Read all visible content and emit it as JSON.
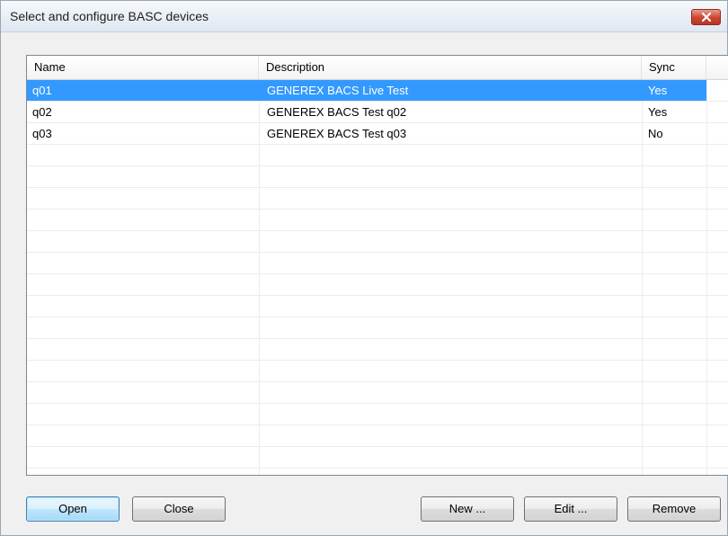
{
  "window": {
    "title": "Select and configure BASC devices"
  },
  "list": {
    "columns": [
      {
        "label": "Name"
      },
      {
        "label": "Description"
      },
      {
        "label": "Sync"
      }
    ],
    "rows": [
      {
        "name": "q01",
        "description": "GENEREX BACS Live Test",
        "sync": "Yes",
        "selected": true
      },
      {
        "name": "q02",
        "description": "GENEREX BACS Test q02",
        "sync": "Yes",
        "selected": false
      },
      {
        "name": "q03",
        "description": "GENEREX BACS Test q03",
        "sync": "No",
        "selected": false
      }
    ]
  },
  "buttons": {
    "open": "Open",
    "close": "Close",
    "new": "New ...",
    "edit": "Edit ...",
    "remove": "Remove"
  },
  "icons": {
    "window_close": "close-icon"
  },
  "colors": {
    "selection": "#3399ff",
    "close_button": "#c9452f"
  }
}
